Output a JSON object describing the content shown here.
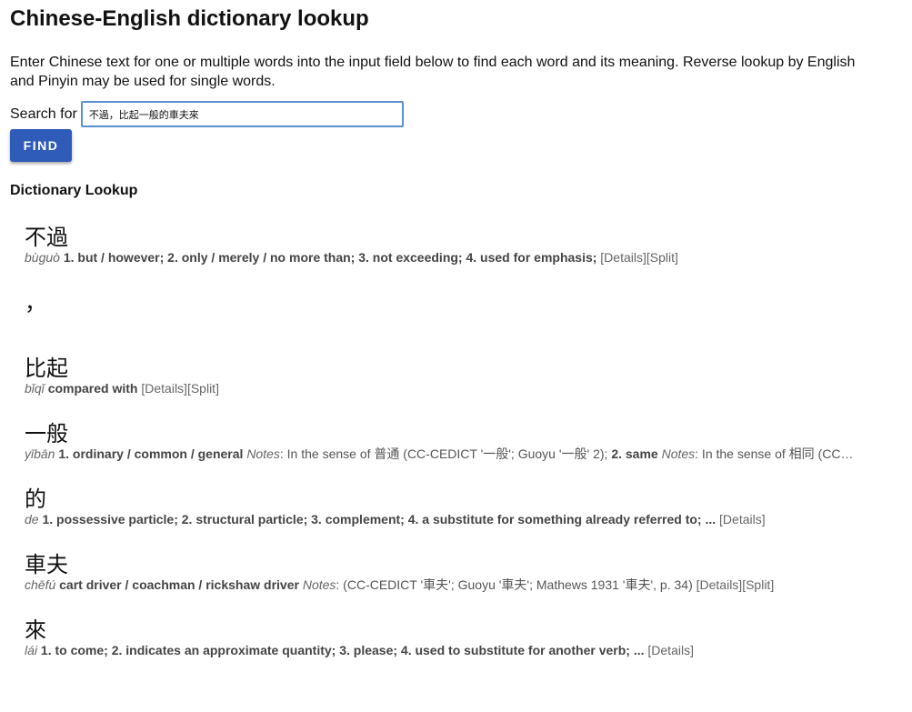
{
  "title": "Chinese-English dictionary lookup",
  "intro": "Enter Chinese text for one or multiple words into the input field below to find each word and its meaning. Reverse lookup by English and Pinyin may be used for single words.",
  "search": {
    "label": "Search for",
    "value": "不過，比起一般的車夫來"
  },
  "find_label": "FIND",
  "section_title": "Dictionary Lookup",
  "entries": [
    {
      "headword": "不過",
      "pinyin": "bùguò",
      "english": "1. but / however; 2. only / merely / no more than; 3. not exceeding; 4. used for emphasis;",
      "notes_label": "",
      "notes": "",
      "links": "[Details][Split]"
    },
    {
      "headword": "，"
    },
    {
      "headword": "比起",
      "pinyin": "bǐqǐ",
      "english": "compared with",
      "notes_label": "",
      "notes": "",
      "links": "[Details][Split]"
    },
    {
      "headword": "一般",
      "pinyin": "yībān",
      "english": "1. ordinary / common / general",
      "notes_label": "Notes",
      "notes": ": In the sense of 普通 (CC-CEDICT '一般'; Guoyu '一般' 2);",
      "english2": "2. same",
      "notes_label2": "Notes",
      "notes2": ": In the sense of 相同 (CC-C…",
      "links": ""
    },
    {
      "headword": "的",
      "pinyin": "de",
      "english": "1. possessive particle; 2. structural particle; 3. complement; 4. a substitute for something already referred to; ...",
      "notes_label": "",
      "notes": "",
      "links": "[Details]"
    },
    {
      "headword": "車夫",
      "pinyin": "chēfú",
      "english": "cart driver / coachman / rickshaw driver",
      "notes_label": "Notes",
      "notes": ": (CC-CEDICT '車夫'; Guoyu '車夫'; Mathews 1931 '車夫', p. 34)",
      "links": "[Details][Split]"
    },
    {
      "headword": "來",
      "pinyin": "lái",
      "english": "1. to come; 2. indicates an approximate quantity; 3. please; 4. used to substitute for another verb; ...",
      "notes_label": "",
      "notes": "",
      "links": "[Details]"
    }
  ]
}
